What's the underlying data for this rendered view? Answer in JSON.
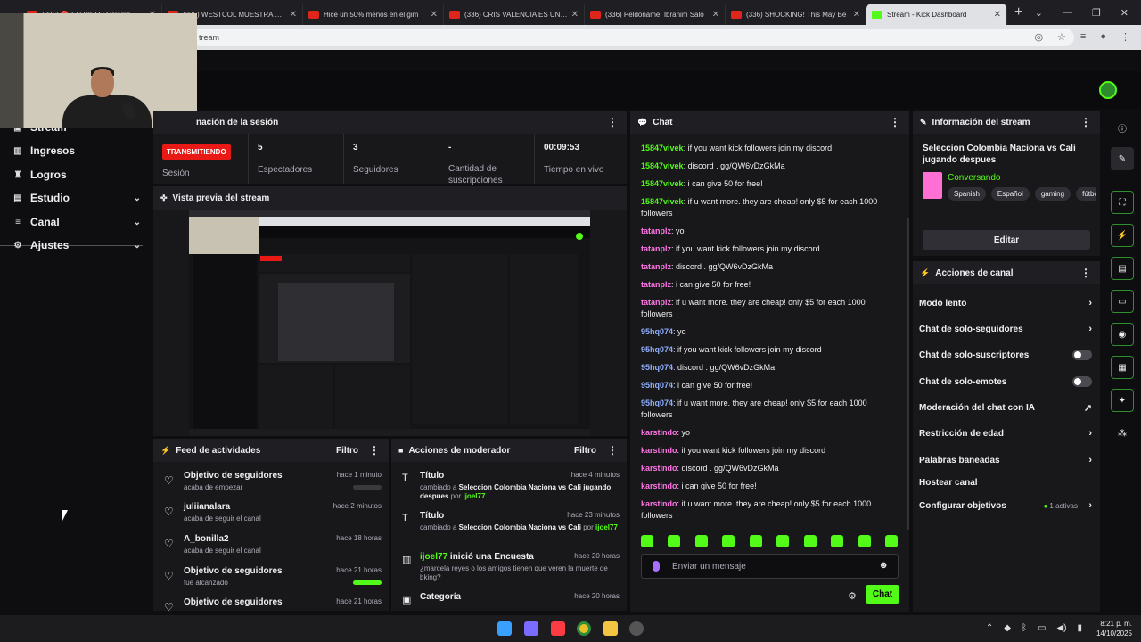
{
  "browser": {
    "tabs": [
      {
        "label": "(336) 🔴 EN VIVO | Colomb",
        "active": false
      },
      {
        "label": "(336) WESTCOL MUESTRA LOS",
        "active": false
      },
      {
        "label": "Hice un 50% menos en el gim",
        "active": false
      },
      {
        "label": "(336) CRIS VALENCIA ES UN M",
        "active": false
      },
      {
        "label": "(336) Peldóname, Ibrahim Salo",
        "active": false
      },
      {
        "label": "(336) SHOCKING! This May Be",
        "active": false
      },
      {
        "label": "Stream - Kick Dashboard",
        "active": true
      }
    ],
    "new_tab": "+",
    "url": "tream"
  },
  "sidebar": {
    "items": [
      {
        "label": "Stream",
        "icon": "stream-icon",
        "chev": ""
      },
      {
        "label": "Ingresos",
        "icon": "wallet-icon",
        "chev": ""
      },
      {
        "label": "Logros",
        "icon": "trophy-icon",
        "chev": ""
      },
      {
        "label": "Estudio",
        "icon": "studio-icon",
        "chev": "⌄"
      },
      {
        "label": "Canal",
        "icon": "channel-icon",
        "chev": "⌄"
      },
      {
        "label": "Ajustes",
        "icon": "gear-icon",
        "chev": "⌄"
      }
    ]
  },
  "session": {
    "header": "nación de la sesión",
    "badge": "TRANSMITIENDO",
    "stats": [
      {
        "value": "",
        "label": "Sesión"
      },
      {
        "value": "5",
        "label": "Espectadores"
      },
      {
        "value": "3",
        "label": "Seguidores"
      },
      {
        "value": "-",
        "label": "Cantidad de suscripciones"
      },
      {
        "value": "00:09:53",
        "label": "Tiempo en vivo"
      }
    ]
  },
  "preview": {
    "header": "Vista previa del stream"
  },
  "feed": {
    "header": "Feed de actividades",
    "filter": "Filtro",
    "items": [
      {
        "title": "Objetivo de seguidores",
        "sub": "acaba de empezar",
        "time": "hace 1 minuto",
        "bar": "empty"
      },
      {
        "title": "juliianalara",
        "sub": "acaba de seguir el canal",
        "time": "hace 2 minutos",
        "bar": ""
      },
      {
        "title": "A_bonilla2",
        "sub": "acaba de seguir el canal",
        "time": "hace 18 horas",
        "bar": ""
      },
      {
        "title": "Objetivo de seguidores",
        "sub": "fue alcanzado",
        "time": "hace 21 horas",
        "bar": "full"
      },
      {
        "title": "Objetivo de seguidores",
        "sub": "",
        "time": "hace 21 horas",
        "bar": ""
      }
    ]
  },
  "mod": {
    "header": "Acciones de moderador",
    "filter": "Filtro",
    "items": [
      {
        "title": "Título",
        "time": "hace 4 minutos",
        "pre": "cambiado a ",
        "bold": "Seleccion Colombia Naciona vs Cali jugando despues",
        "mid": " por ",
        "user": "ijoel77"
      },
      {
        "title": "Título",
        "time": "hace 23 minutos",
        "pre": "cambiado a ",
        "bold": "Seleccion Colombia Naciona vs Cali",
        "mid": " por ",
        "user": "ijoel77"
      },
      {
        "title_user": "ijoel77",
        "title": " inició una Encuesta",
        "time": "hace 20 horas",
        "desc": "¿marcela reyes o los amigos tienen que veren la muerte de bking?"
      },
      {
        "title": "Categoría",
        "time": "hace 20 horas"
      }
    ]
  },
  "chat": {
    "header": "Chat",
    "messages": [
      {
        "user": "15847vivek",
        "color": "green",
        "text": "if you want kick followers join my discord"
      },
      {
        "user": "15847vivek",
        "color": "green",
        "text": "discord . gg/QW6vDzGkMa"
      },
      {
        "user": "15847vivek",
        "color": "green",
        "text": "i can give 50 for free!"
      },
      {
        "user": "15847vivek",
        "color": "green",
        "text": "if u want more. they are cheap! only $5 for each 1000 followers"
      },
      {
        "user": "tatanplz",
        "color": "pink",
        "text": "yo"
      },
      {
        "user": "tatanplz",
        "color": "pink",
        "text": "if you want kick followers join my discord"
      },
      {
        "user": "tatanplz",
        "color": "pink",
        "text": "discord . gg/QW6vDzGkMa"
      },
      {
        "user": "tatanplz",
        "color": "pink",
        "text": "i can give 50 for free!"
      },
      {
        "user": "tatanplz",
        "color": "pink",
        "text": "if u want more. they are cheap! only $5 for each 1000 followers"
      },
      {
        "user": "95hq074",
        "color": "blue",
        "text": "yo"
      },
      {
        "user": "95hq074",
        "color": "blue",
        "text": "if you want kick followers join my discord"
      },
      {
        "user": "95hq074",
        "color": "blue",
        "text": "discord . gg/QW6vDzGkMa"
      },
      {
        "user": "95hq074",
        "color": "blue",
        "text": "i can give 50 for free!"
      },
      {
        "user": "95hq074",
        "color": "blue",
        "text": "if u want more. they are cheap! only $5 for each 1000 followers"
      },
      {
        "user": "karstindo",
        "color": "pink",
        "text": "yo"
      },
      {
        "user": "karstindo",
        "color": "pink",
        "text": "if you want kick followers join my discord"
      },
      {
        "user": "karstindo",
        "color": "pink",
        "text": "discord . gg/QW6vDzGkMa"
      },
      {
        "user": "karstindo",
        "color": "pink",
        "text": "i can give 50 for free!"
      },
      {
        "user": "karstindo",
        "color": "pink",
        "text": "if u want more. they are cheap! only $5 for each 1000 followers"
      }
    ],
    "placeholder": "Enviar un mensaje",
    "send_label": "Chat"
  },
  "stream_info": {
    "header": "Información del stream",
    "title": "Seleccion Colombia Naciona vs Cali jugando despues",
    "category": "Conversando",
    "tags": [
      "Spanish",
      "Español",
      "gaming",
      "fútbol"
    ],
    "edit_label": "Editar"
  },
  "channel_actions": {
    "header": "Acciones de canal",
    "items": [
      {
        "label": "Modo lento",
        "control": "arrow"
      },
      {
        "label": "Chat de solo-seguidores",
        "control": "arrow"
      },
      {
        "label": "Chat de solo-suscriptores",
        "control": "toggle"
      },
      {
        "label": "Chat de solo-emotes",
        "control": "toggle"
      },
      {
        "label": "Moderación del chat con IA",
        "control": "external"
      },
      {
        "label": "Restricción de edad",
        "control": "arrow"
      },
      {
        "label": "Palabras baneadas",
        "control": "arrow"
      },
      {
        "label": "Hostear canal",
        "control": ""
      },
      {
        "label": "Configurar objetivos",
        "control": "arrow",
        "badge": "1 activas"
      }
    ]
  },
  "taskbar": {
    "time": "8:21 p. m.",
    "date": "14/10/2025"
  },
  "colors": {
    "accent": "#53fc18",
    "live": "#e91916"
  }
}
